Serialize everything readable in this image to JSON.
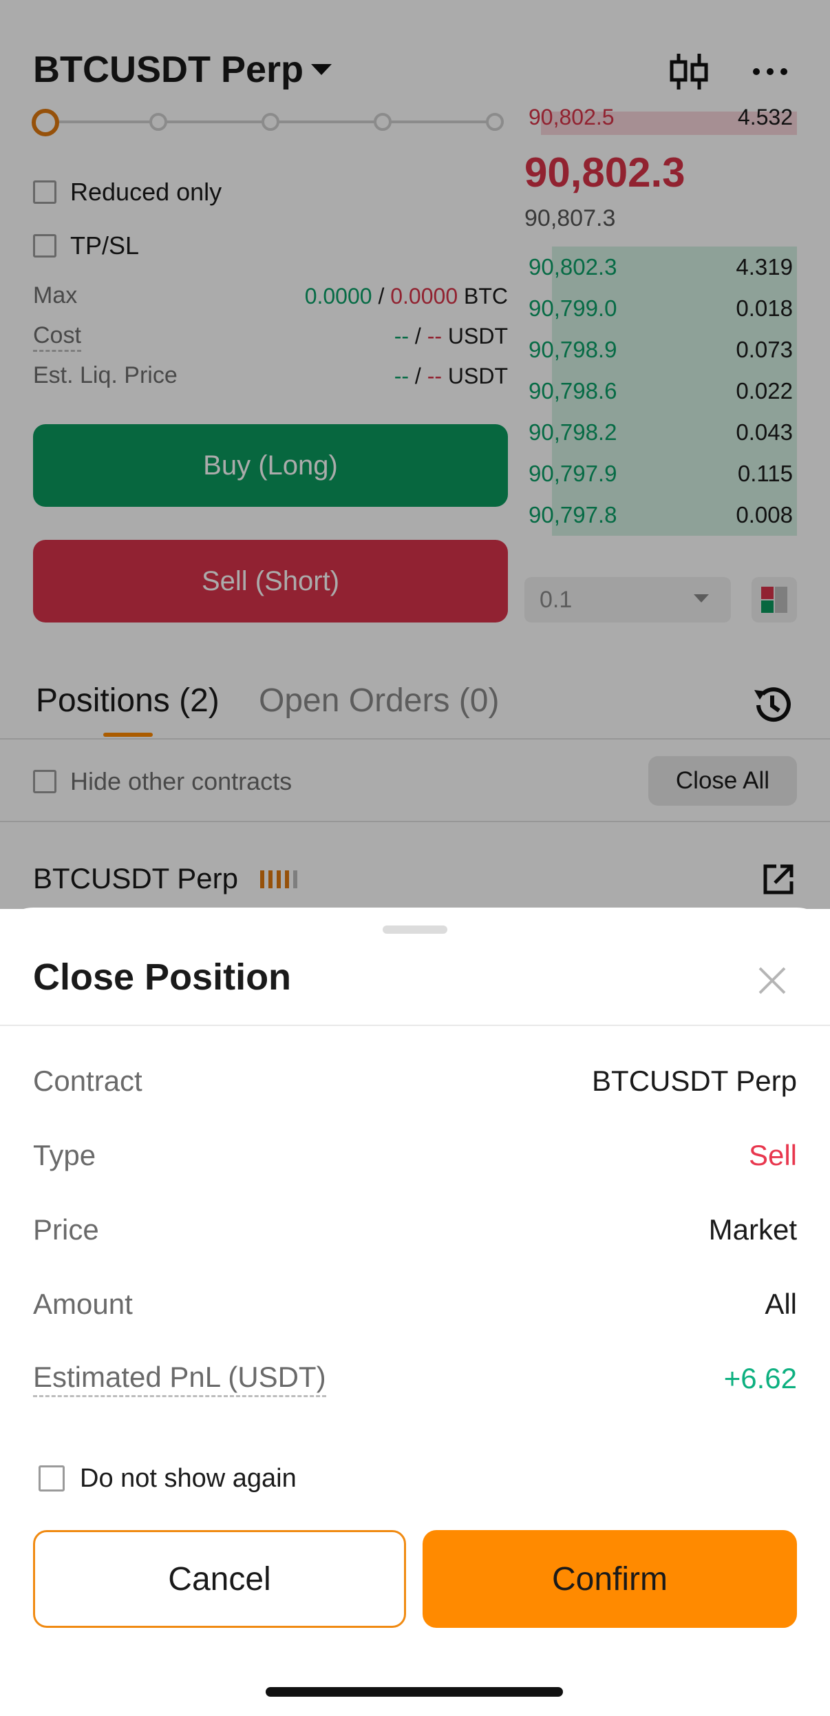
{
  "header": {
    "title": "BTCUSDT Perp"
  },
  "form": {
    "reduced_only": "Reduced only",
    "tpsl": "TP/SL",
    "max_label": "Max",
    "max_value_green": "0.0000",
    "max_sep": "/",
    "max_value_red": "0.0000",
    "max_unit": "BTC",
    "cost_label": "Cost",
    "cost_green": "--",
    "cost_sep": "/",
    "cost_red": "--",
    "cost_unit": "USDT",
    "liq_label": "Est. Liq. Price",
    "liq_green": "--",
    "liq_sep": "/",
    "liq_red": "--",
    "liq_unit": "USDT",
    "buy_label": "Buy (Long)",
    "sell_label": "Sell (Short)"
  },
  "orderbook": {
    "top_ask_price": "90,802.5",
    "top_ask_qty": "4.532",
    "last_price": "90,802.3",
    "mark_price": "90,807.3",
    "bids": [
      {
        "price": "90,802.3",
        "qty": "4.319"
      },
      {
        "price": "90,799.0",
        "qty": "0.018"
      },
      {
        "price": "90,798.9",
        "qty": "0.073"
      },
      {
        "price": "90,798.6",
        "qty": "0.022"
      },
      {
        "price": "90,798.2",
        "qty": "0.043"
      },
      {
        "price": "90,797.9",
        "qty": "0.115"
      },
      {
        "price": "90,797.8",
        "qty": "0.008"
      }
    ],
    "precision": "0.1"
  },
  "tabs": {
    "positions": "Positions (2)",
    "open_orders": "Open Orders (0)"
  },
  "filter": {
    "hide_other": "Hide other contracts",
    "close_all": "Close All"
  },
  "position": {
    "symbol": "BTCUSDT Perp"
  },
  "sheet": {
    "title": "Close Position",
    "rows": [
      {
        "key": "Contract",
        "value": "BTCUSDT Perp"
      },
      {
        "key": "Type",
        "value": "Sell"
      },
      {
        "key": "Price",
        "value": "Market"
      },
      {
        "key": "Amount",
        "value": "All"
      },
      {
        "key": "Estimated PnL (USDT)",
        "value": "+6.62"
      }
    ],
    "do_not_show": "Do not show again",
    "cancel": "Cancel",
    "confirm": "Confirm"
  },
  "colors": {
    "accent": "#ff8a00",
    "buy": "#0b9a5e",
    "sell": "#d9344b",
    "positive": "#0aa067"
  }
}
